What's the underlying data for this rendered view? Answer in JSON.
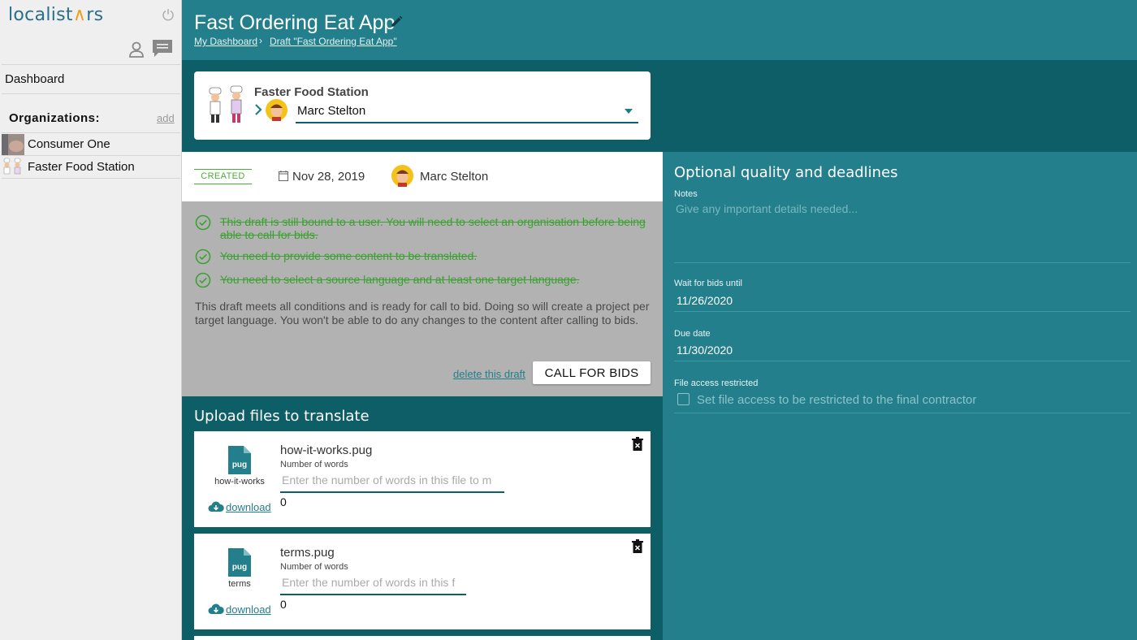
{
  "sidebar": {
    "logo_left": "localist",
    "logo_star": "∧",
    "logo_right": "rs",
    "nav_dashboard": "Dashboard",
    "organizations_title": "Organizations:",
    "add_label": "add",
    "organizations": [
      {
        "name": "Consumer One"
      },
      {
        "name": "Faster Food Station"
      }
    ]
  },
  "header": {
    "title": "Fast Ordering Eat App",
    "breadcrumbs": [
      "My Dashboard",
      "Draft \"Fast Ordering Eat App\""
    ],
    "breadcrumb_separator": "›"
  },
  "client": {
    "organization": "Faster Food Station",
    "selected_user": "Marc Stelton"
  },
  "status": {
    "badge": "CREATED",
    "date": "Nov 28, 2019",
    "owner": "Marc Stelton"
  },
  "conditions": {
    "items": [
      {
        "text": "This draft is still bound to a user. You will need to select an organisation before being able to call for bids."
      },
      {
        "text": "You need to provide some content to be translated."
      },
      {
        "text": "You need to select a source language and at least one target language."
      }
    ],
    "ready_text": "This draft meets all conditions and is ready for call to bid. Doing so will create a project per target language. You won't be able to do any changes to the content after calling to bids.",
    "delete_link": "delete this draft",
    "call_button": "CALL FOR BIDS"
  },
  "upload": {
    "title": "Upload files to translate",
    "files": [
      {
        "filename": "how-it-works.pug",
        "ext": "pug",
        "short_name": "how-it-works",
        "words_label": "Number of words",
        "placeholder": "Enter the number of words in this file to m",
        "count": "0",
        "download": "download"
      },
      {
        "filename": "terms.pug",
        "ext": "pug",
        "short_name": "terms",
        "words_label": "Number of words",
        "placeholder": "Enter the number of words in this f",
        "count": "0",
        "download": "download"
      }
    ]
  },
  "optional": {
    "title": "Optional quality and deadlines",
    "notes_label": "Notes",
    "notes_placeholder": "Give any important details needed...",
    "wait_label": "Wait for bids until",
    "wait_value": "11/26/2020",
    "due_label": "Due date",
    "due_value": "11/30/2020",
    "file_access_label": "File access restricted",
    "file_access_checkbox": "Set file access to be restricted to the final contractor"
  },
  "colors": {
    "teal": "#237f8b",
    "dark_teal": "#0e5e68",
    "success_green": "#3ba130",
    "logo_blue": "#2a6f8a",
    "logo_orange": "#f0a020"
  }
}
